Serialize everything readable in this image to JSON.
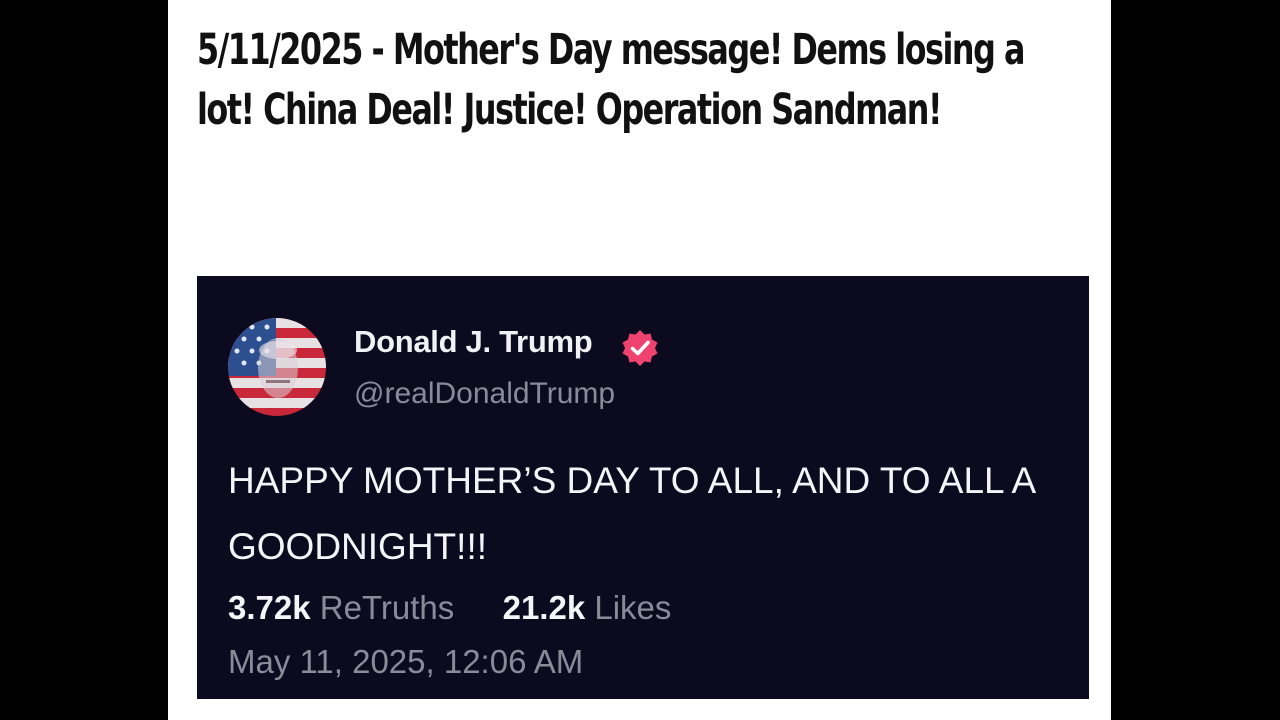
{
  "headline": "5/11/2025 - Mother's Day message! Dems losing a lot!  China Deal! Justice! Operation Sandman!",
  "post": {
    "author_name": "Donald J. Trump",
    "author_handle": "@realDonaldTrump",
    "text": "HAPPY MOTHER’S DAY TO ALL, AND TO ALL A GOODNIGHT!!!",
    "retruths_count": "3.72k",
    "retruths_label": "ReTruths",
    "likes_count": "21.2k",
    "likes_label": "Likes",
    "timestamp": "May 11, 2025, 12:06 AM",
    "verified_icon": "verified-badge-icon",
    "avatar_icon": "profile-avatar"
  },
  "colors": {
    "background": "#000000",
    "page": "#ffffff",
    "card_background": "#0b0a1f",
    "verified_badge": "#f0426e",
    "muted_text": "#8c8a99"
  }
}
